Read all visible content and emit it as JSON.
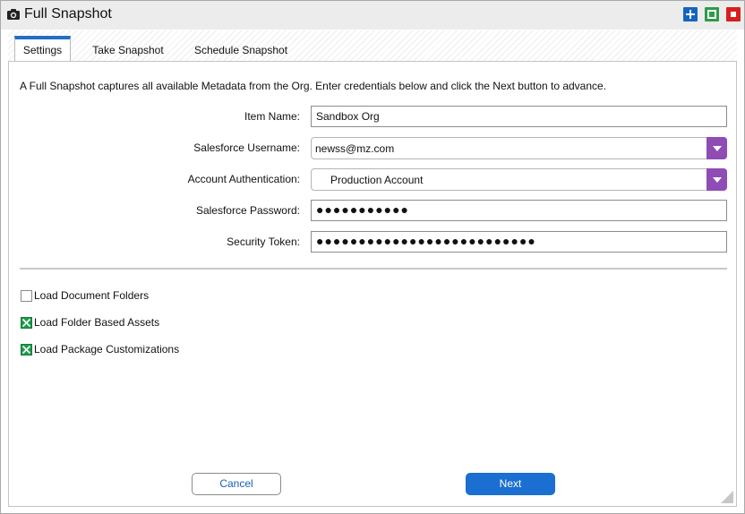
{
  "window": {
    "title": "Full Snapshot",
    "icon": "camera-icon"
  },
  "colors": {
    "tab_accent": "#1f6fc5",
    "dropdown_accent": "#8f4cb5",
    "next_button": "#1a6fd1",
    "checkbox_checked": "#1e9a4d",
    "win_plus": "#1565c0",
    "win_max": "#2e9b48",
    "win_close": "#d81e1e"
  },
  "tabs": [
    {
      "label": "Settings",
      "active": true
    },
    {
      "label": "Take Snapshot",
      "active": false
    },
    {
      "label": "Schedule Snapshot",
      "active": false
    }
  ],
  "description": "A Full Snapshot captures all available Metadata from the Org. Enter credentials below and click the Next button to advance.",
  "form": {
    "item_name": {
      "label": "Item Name:",
      "value": "Sandbox Org"
    },
    "username": {
      "label": "Salesforce Username:",
      "value": "newss@mz.com"
    },
    "auth": {
      "label": "Account Authentication:",
      "value": "Production Account"
    },
    "password": {
      "label": "Salesforce Password:",
      "value": "●●●●●●●●●●●"
    },
    "token": {
      "label": "Security Token:",
      "value": "●●●●●●●●●●●●●●●●●●●●●●●●●●"
    }
  },
  "options": [
    {
      "label": "Load Document Folders",
      "checked": false
    },
    {
      "label": "Load Folder Based Assets",
      "checked": true
    },
    {
      "label": "Load Package Customizations",
      "checked": true
    }
  ],
  "buttons": {
    "cancel": "Cancel",
    "next": "Next"
  }
}
